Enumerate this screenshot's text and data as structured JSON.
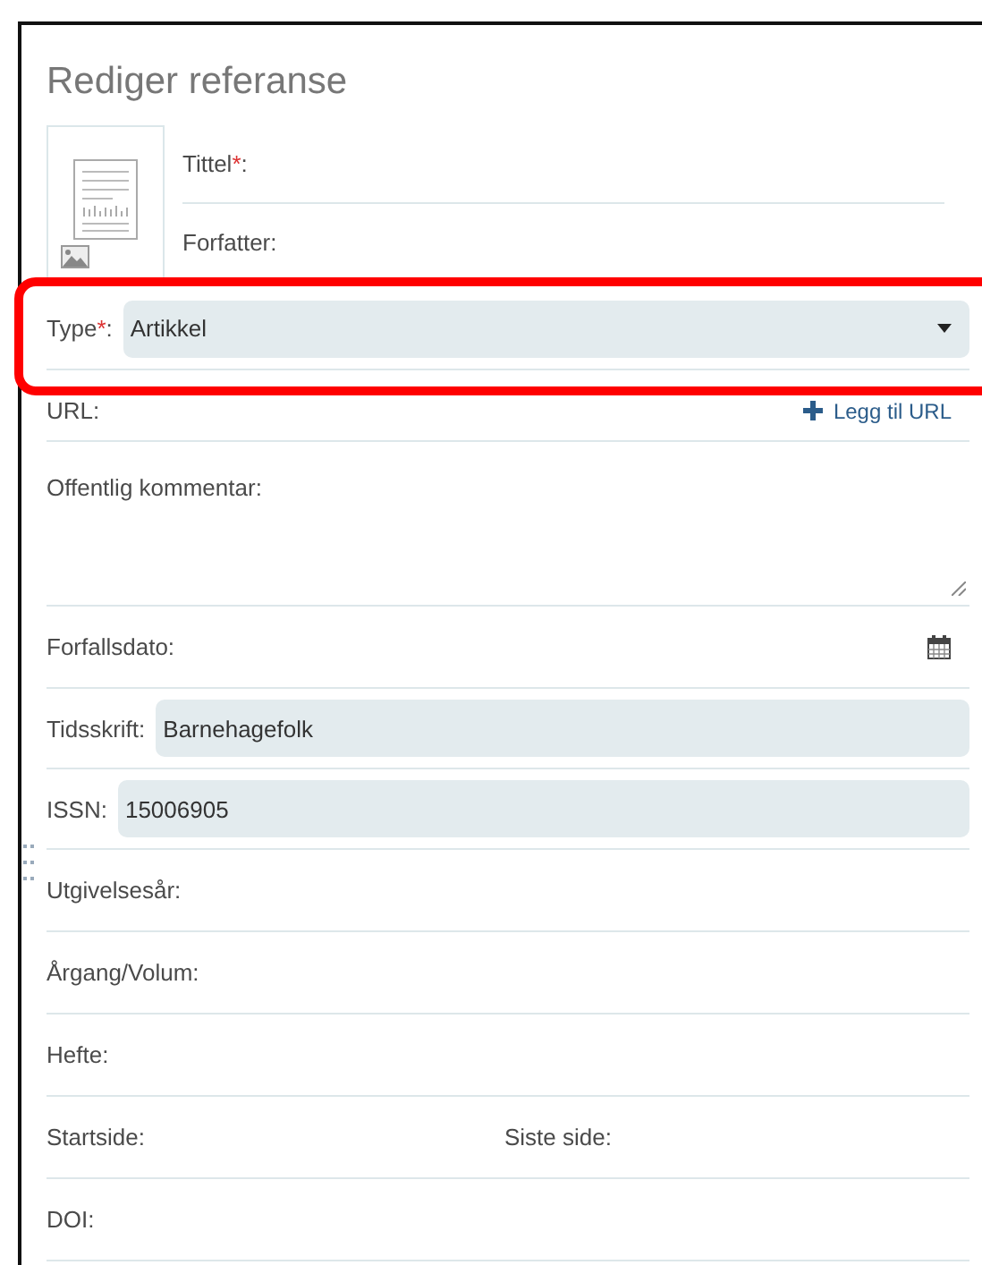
{
  "title": "Rediger referanse",
  "required_mark": "*",
  "label_suffix": ":",
  "cover_fields": [
    {
      "label": "Tittel",
      "required": true
    },
    {
      "label": "Forfatter",
      "required": false
    }
  ],
  "rows": [
    {
      "kind": "select",
      "label": "Type",
      "required": true,
      "value": "Artikkel",
      "highlighted": true
    },
    {
      "kind": "url",
      "label": "URL",
      "required": false,
      "action": "Legg til URL"
    },
    {
      "kind": "textarea",
      "label": "Offentlig kommentar",
      "required": false
    },
    {
      "kind": "date",
      "label": "Forfallsdato",
      "required": false
    },
    {
      "kind": "filled",
      "label": "Tidsskrift",
      "required": false,
      "value": "Barnehagefolk"
    },
    {
      "kind": "filled",
      "label": "ISSN",
      "required": false,
      "value": "15006905"
    },
    {
      "kind": "line",
      "label": "Utgivelsesår",
      "required": false
    },
    {
      "kind": "line",
      "label": "Årgang/Volum",
      "required": false
    },
    {
      "kind": "line",
      "label": "Hefte",
      "required": false
    },
    {
      "kind": "pair",
      "labels": [
        "Startside",
        "Siste side"
      ]
    },
    {
      "kind": "line",
      "label": "DOI",
      "required": false
    }
  ]
}
